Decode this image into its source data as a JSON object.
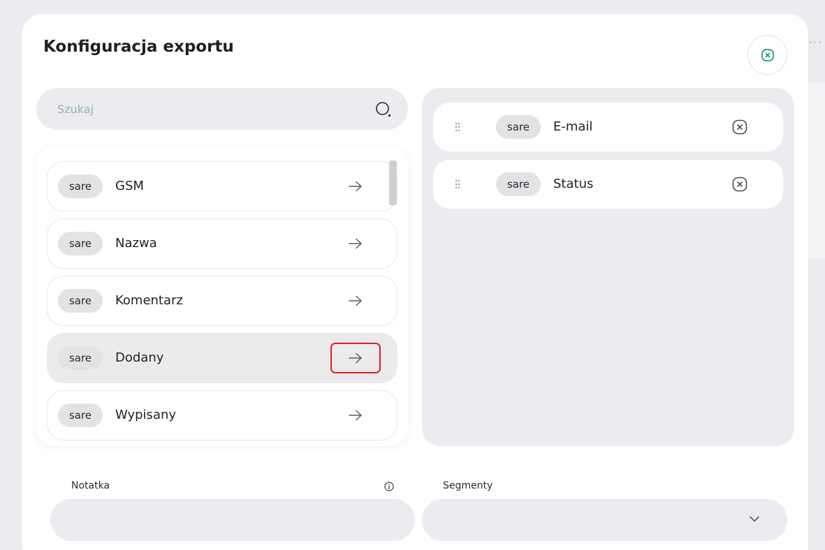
{
  "modal": {
    "title": "Konfiguracja exportu",
    "close_icon": "close-circle-icon"
  },
  "search": {
    "placeholder": "Szukaj",
    "icon": "search-icon"
  },
  "available_fields": [
    {
      "tag": "sare",
      "label": "GSM"
    },
    {
      "tag": "sare",
      "label": "Nazwa"
    },
    {
      "tag": "sare",
      "label": "Komentarz"
    },
    {
      "tag": "sare",
      "label": "Dodany"
    },
    {
      "tag": "sare",
      "label": "Wypisany"
    }
  ],
  "selected_fields": [
    {
      "tag": "sare",
      "label": "E-mail"
    },
    {
      "tag": "sare",
      "label": "Status"
    }
  ],
  "form": {
    "note_label": "Notatka",
    "segments_label": "Segmenty"
  },
  "colors": {
    "accent": "#1f9a6b",
    "highlight": "#e01e2a"
  }
}
